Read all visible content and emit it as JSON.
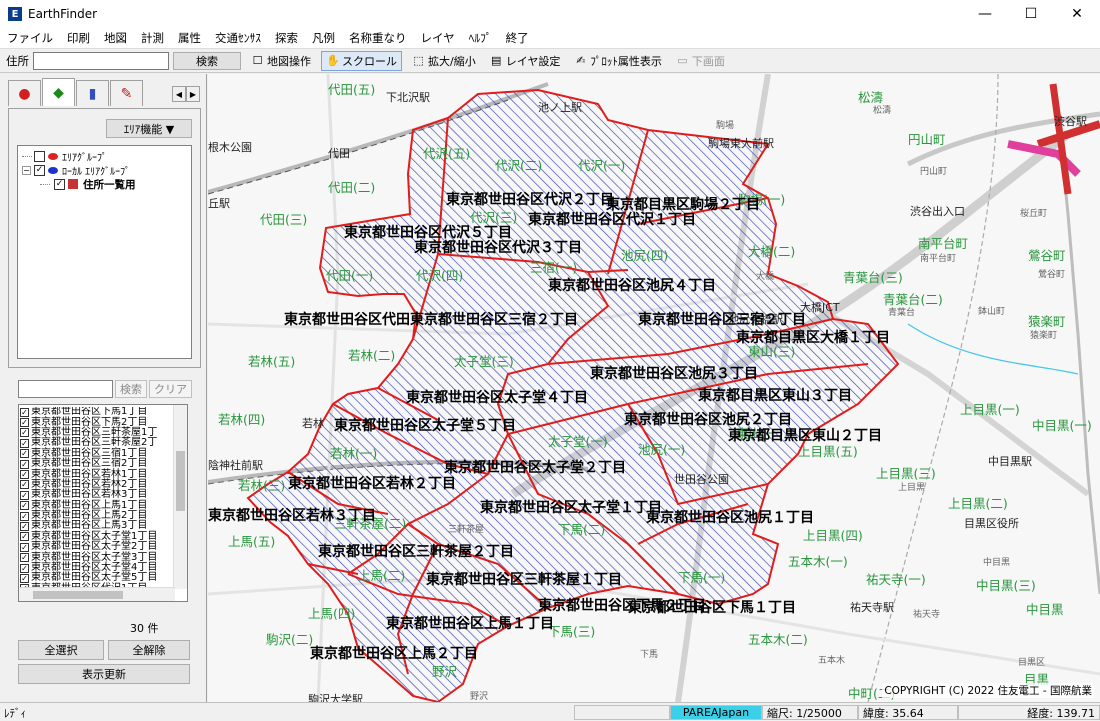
{
  "window": {
    "title": "EarthFinder",
    "app_icon": "ef-logo-icon"
  },
  "menu": [
    "ファイル",
    "印刷",
    "地図",
    "計測",
    "属性",
    "交通ｾﾝｻｽ",
    "探索",
    "凡例",
    "名称重なり",
    "レイヤ",
    "ﾍﾙﾌﾟ",
    "終了"
  ],
  "toolbar": {
    "address_label": "住所",
    "address_value": "",
    "search_label": "検索",
    "tools": [
      {
        "label": "地図操作",
        "icon": "hand-icon"
      },
      {
        "label": "スクロール",
        "icon": "hand-scroll-icon",
        "active": true
      },
      {
        "label": "拡大/縮小",
        "icon": "zoom-box-icon"
      },
      {
        "label": "レイヤ設定",
        "icon": "layers-icon"
      },
      {
        "label": "ﾌﾟﾛｯﾄ属性表示",
        "icon": "plot-attr-icon"
      },
      {
        "label": "下画面",
        "icon": "lower-pane-icon",
        "disabled": true
      }
    ]
  },
  "left_panel": {
    "area_func_label": "ｴﾘｱ機能 ▼",
    "tree": [
      {
        "label": "ｴﾘｱｸﾞﾙｰﾌﾟ",
        "checked": false,
        "color": "#e02020",
        "level": 0
      },
      {
        "label": "ﾛｰｶﾙ ｴﾘｱｸﾞﾙｰﾌﾟ",
        "checked": true,
        "color": "#2030d0",
        "level": 0
      },
      {
        "label": "住所一覧用",
        "checked": true,
        "level": 1
      }
    ],
    "search_placeholder": "",
    "search_label": "検索",
    "clear_label": "クリア",
    "list": [
      "東京都世田谷区下馬1丁目",
      "東京都世田谷区下馬2丁目",
      "東京都世田谷区三軒茶屋1丁",
      "東京都世田谷区三軒茶屋2丁",
      "東京都世田谷区三宿1丁目",
      "東京都世田谷区三宿2丁目",
      "東京都世田谷区若林1丁目",
      "東京都世田谷区若林2丁目",
      "東京都世田谷区若林3丁目",
      "東京都世田谷区上馬1丁目",
      "東京都世田谷区上馬2丁目",
      "東京都世田谷区上馬3丁目",
      "東京都世田谷区太子堂1丁目",
      "東京都世田谷区太子堂2丁目",
      "東京都世田谷区太子堂3丁目",
      "東京都世田谷区太子堂4丁目",
      "東京都世田谷区太子堂5丁目",
      "東京都世田谷区代沢1丁目"
    ],
    "count_label": "30 件",
    "select_all_label": "全選択",
    "deselect_all_label": "全解除",
    "refresh_label": "表示更新"
  },
  "map": {
    "green_labels": [
      [
        "代田(五)",
        120,
        8
      ],
      [
        "松濤",
        650,
        16
      ],
      [
        "円山町",
        700,
        58
      ],
      [
        "代沢(五)",
        215,
        72
      ],
      [
        "代沢(二)",
        287,
        84
      ],
      [
        "代沢(一)",
        370,
        84
      ],
      [
        "代田(二)",
        120,
        106
      ],
      [
        "駒場(一)",
        530,
        118
      ],
      [
        "代田(三)",
        52,
        138
      ],
      [
        "代沢(三)",
        262,
        136
      ],
      [
        "大橋(二)",
        540,
        170
      ],
      [
        "南平台町",
        710,
        162
      ],
      [
        "鶯谷町",
        820,
        174
      ],
      [
        "池尻(四)",
        413,
        174
      ],
      [
        "三宿(一)",
        322,
        186
      ],
      [
        "代田(一)",
        118,
        194
      ],
      [
        "代沢(四)",
        208,
        194
      ],
      [
        "青葉台(三)",
        635,
        196
      ],
      [
        "青葉台(二)",
        675,
        218
      ],
      [
        "猿楽町",
        820,
        240
      ],
      [
        "若林(五)",
        40,
        280
      ],
      [
        "若林(二)",
        140,
        274
      ],
      [
        "太子堂(三)",
        246,
        280
      ],
      [
        "東山(三)",
        540,
        270
      ],
      [
        "若林(四)",
        10,
        338
      ],
      [
        "上目黒(一)",
        752,
        328
      ],
      [
        "中目黒(一)",
        824,
        344
      ],
      [
        "若林(一)",
        122,
        372
      ],
      [
        "太子堂(一)",
        340,
        360
      ],
      [
        "池尻(一)",
        430,
        368
      ],
      [
        "東山(一)",
        528,
        352
      ],
      [
        "上目黒(五)",
        590,
        370
      ],
      [
        "若林(三)",
        30,
        404
      ],
      [
        "上目黒(三)",
        668,
        392
      ],
      [
        "上目黒(二)",
        740,
        422
      ],
      [
        "上馬(五)",
        20,
        460
      ],
      [
        "三軒茶屋(二)",
        126,
        442
      ],
      [
        "下馬(二)",
        350,
        448
      ],
      [
        "上目黒(四)",
        595,
        454
      ],
      [
        "五本木(一)",
        580,
        480
      ],
      [
        "祐天寺(一)",
        658,
        498
      ],
      [
        "中目黒(三)",
        768,
        504
      ],
      [
        "上馬(二)",
        150,
        494
      ],
      [
        "上馬(四)",
        100,
        532
      ],
      [
        "下馬(一)",
        470,
        496
      ],
      [
        "中目黒",
        818,
        528
      ],
      [
        "下馬(三)",
        340,
        550
      ],
      [
        "駒沢(二)",
        58,
        558
      ],
      [
        "五本木(二)",
        540,
        558
      ],
      [
        "野沢",
        224,
        590
      ],
      [
        "中町(二)",
        640,
        612
      ],
      [
        "目黒",
        816,
        598
      ]
    ],
    "dark_labels": [
      [
        "下北沢駅",
        178,
        16
      ],
      [
        "池ノ上駅",
        330,
        26
      ],
      [
        "駒場東大前駅",
        500,
        62
      ],
      [
        "根木公園",
        0,
        66
      ],
      [
        "代田",
        120,
        72
      ],
      [
        "丘駅",
        0,
        122
      ],
      [
        "渋谷出入口",
        702,
        130
      ],
      [
        "池尻大橋駅",
        520,
        238
      ],
      [
        "大橋JCT",
        592,
        226
      ],
      [
        "若林",
        94,
        342
      ],
      [
        "中目黒駅",
        780,
        380
      ],
      [
        "世田谷公園",
        466,
        398
      ],
      [
        "目黒区役所",
        756,
        442
      ],
      [
        "祐天寺駅",
        642,
        526
      ],
      [
        "駒沢大学駅",
        100,
        618
      ],
      [
        "陰神社前駅",
        0,
        384
      ],
      [
        "渋谷駅",
        846,
        40
      ]
    ],
    "small_labels": [
      [
        "松濤",
        665,
        30
      ],
      [
        "駒場",
        508,
        45
      ],
      [
        "円山町",
        712,
        91
      ],
      [
        "桜丘町",
        812,
        133
      ],
      [
        "南平台町",
        712,
        178
      ],
      [
        "鶯谷町",
        830,
        194
      ],
      [
        "大橋",
        548,
        196
      ],
      [
        "青葉台",
        680,
        232
      ],
      [
        "鉢山町",
        770,
        231
      ],
      [
        "猿楽町",
        822,
        255
      ],
      [
        "上目黒",
        690,
        407
      ],
      [
        "祐天寺",
        705,
        534
      ],
      [
        "中目黒",
        775,
        482
      ],
      [
        "下馬",
        432,
        574
      ],
      [
        "五本木",
        610,
        580
      ],
      [
        "目黒区",
        810,
        582
      ],
      [
        "野沢",
        262,
        616
      ],
      [
        "三軒茶屋",
        240,
        449
      ]
    ],
    "bold_labels": [
      [
        "東京都世田谷区代沢２丁目",
        238,
        116
      ],
      [
        "東京都目黒区駒場２丁目",
        398,
        121
      ],
      [
        "東京都世田谷区代沢１丁目",
        320,
        136
      ],
      [
        "東京都世田谷区代沢５丁目",
        136,
        149
      ],
      [
        "東京都世田谷区代沢３丁目",
        206,
        164
      ],
      [
        "東京都世田谷区池尻４丁目",
        340,
        202
      ],
      [
        "東京都世田谷区代田東京都世田谷区三宿２丁目",
        76,
        236
      ],
      [
        "東京都世田谷区三宿２丁目",
        430,
        236
      ],
      [
        "東京都目黒区大橋１丁目",
        528,
        254
      ],
      [
        "東京都世田谷区池尻３丁目",
        382,
        290
      ],
      [
        "東京都世田谷区太子堂４丁目",
        198,
        314
      ],
      [
        "東京都目黒区東山３丁目",
        490,
        312
      ],
      [
        "東京都世田谷区池尻２丁目",
        416,
        336
      ],
      [
        "東京都世田谷区太子堂５丁目",
        126,
        342
      ],
      [
        "東京都目黒区東山２丁目",
        520,
        352
      ],
      [
        "東京都世田谷区太子堂２丁目",
        236,
        384
      ],
      [
        "東京都世田谷区若林２丁目",
        80,
        400
      ],
      [
        "東京都世田谷区太子堂１丁目",
        272,
        424
      ],
      [
        "東京都世田谷区池尻１丁目",
        438,
        434
      ],
      [
        "東京都世田谷区若林３丁目",
        0,
        432
      ],
      [
        "東京都世田谷区三軒茶屋２丁目",
        110,
        468
      ],
      [
        "東京都世田谷区三軒茶屋１丁目",
        218,
        496
      ],
      [
        "東京都世田谷区下馬２丁目",
        330,
        522
      ],
      [
        "東京都世田谷区下馬１丁目",
        420,
        524
      ],
      [
        "東京都世田谷区上馬１丁目",
        178,
        540
      ],
      [
        "東京都世田谷区上馬２丁目",
        102,
        570
      ]
    ],
    "copyright": "COPYRIGHT (C) 2022 住友電工 - 国際航業"
  },
  "status": {
    "ready": "ﾚﾃﾞｨ",
    "brand": "PAREAJapan",
    "scale": "縮尺: 1/25000",
    "lat": "緯度: 35.64",
    "lon": "経度: 139.71"
  }
}
